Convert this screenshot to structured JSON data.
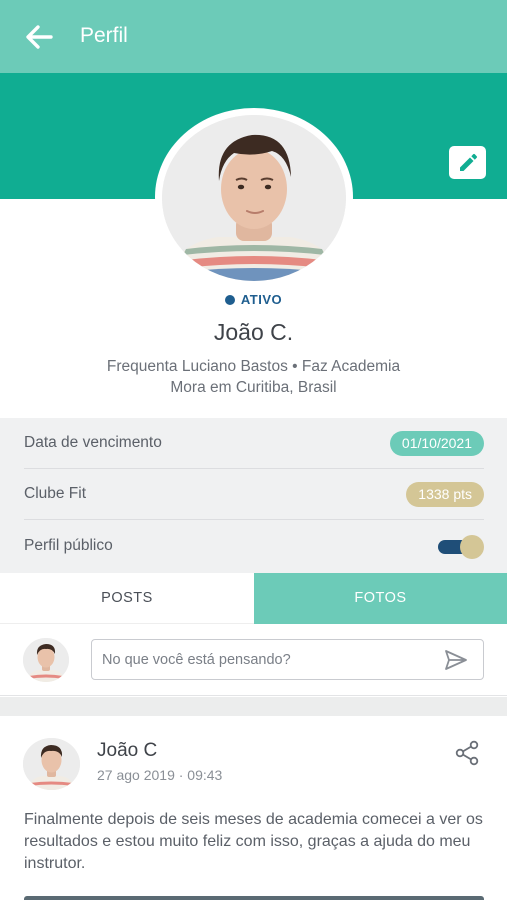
{
  "header": {
    "title": "Perfil",
    "back_icon": "arrow-left-icon"
  },
  "profile": {
    "status": "ATIVO",
    "name": "João C.",
    "line1": "Frequenta Luciano Bastos • Faz Academia",
    "line2": "Mora em Curitiba, Brasil",
    "edit_icon": "pencil-icon"
  },
  "info": {
    "due_label": "Data de vencimento",
    "due_value": "01/10/2021",
    "club_label": "Clube Fit",
    "club_value": "1338 pts",
    "public_label": "Perfil público",
    "public_enabled": true
  },
  "tabs": [
    {
      "label": "POSTS",
      "active": false
    },
    {
      "label": "FOTOS",
      "active": true
    }
  ],
  "composer": {
    "placeholder": "No que você está pensando?",
    "send_icon": "send-icon"
  },
  "post": {
    "author": "João C",
    "date": "27 ago 2019 · 09:43",
    "text": "Finalmente depois de seis meses de academia comecei a ver os resultados e estou muito feliz com isso, graças a ajuda do meu instrutor.",
    "share_icon": "share-icon"
  },
  "colors": {
    "header": "#6ccbb8",
    "hero": "#10ad92",
    "status": "#1f5e8f",
    "points": "#d4c696"
  }
}
